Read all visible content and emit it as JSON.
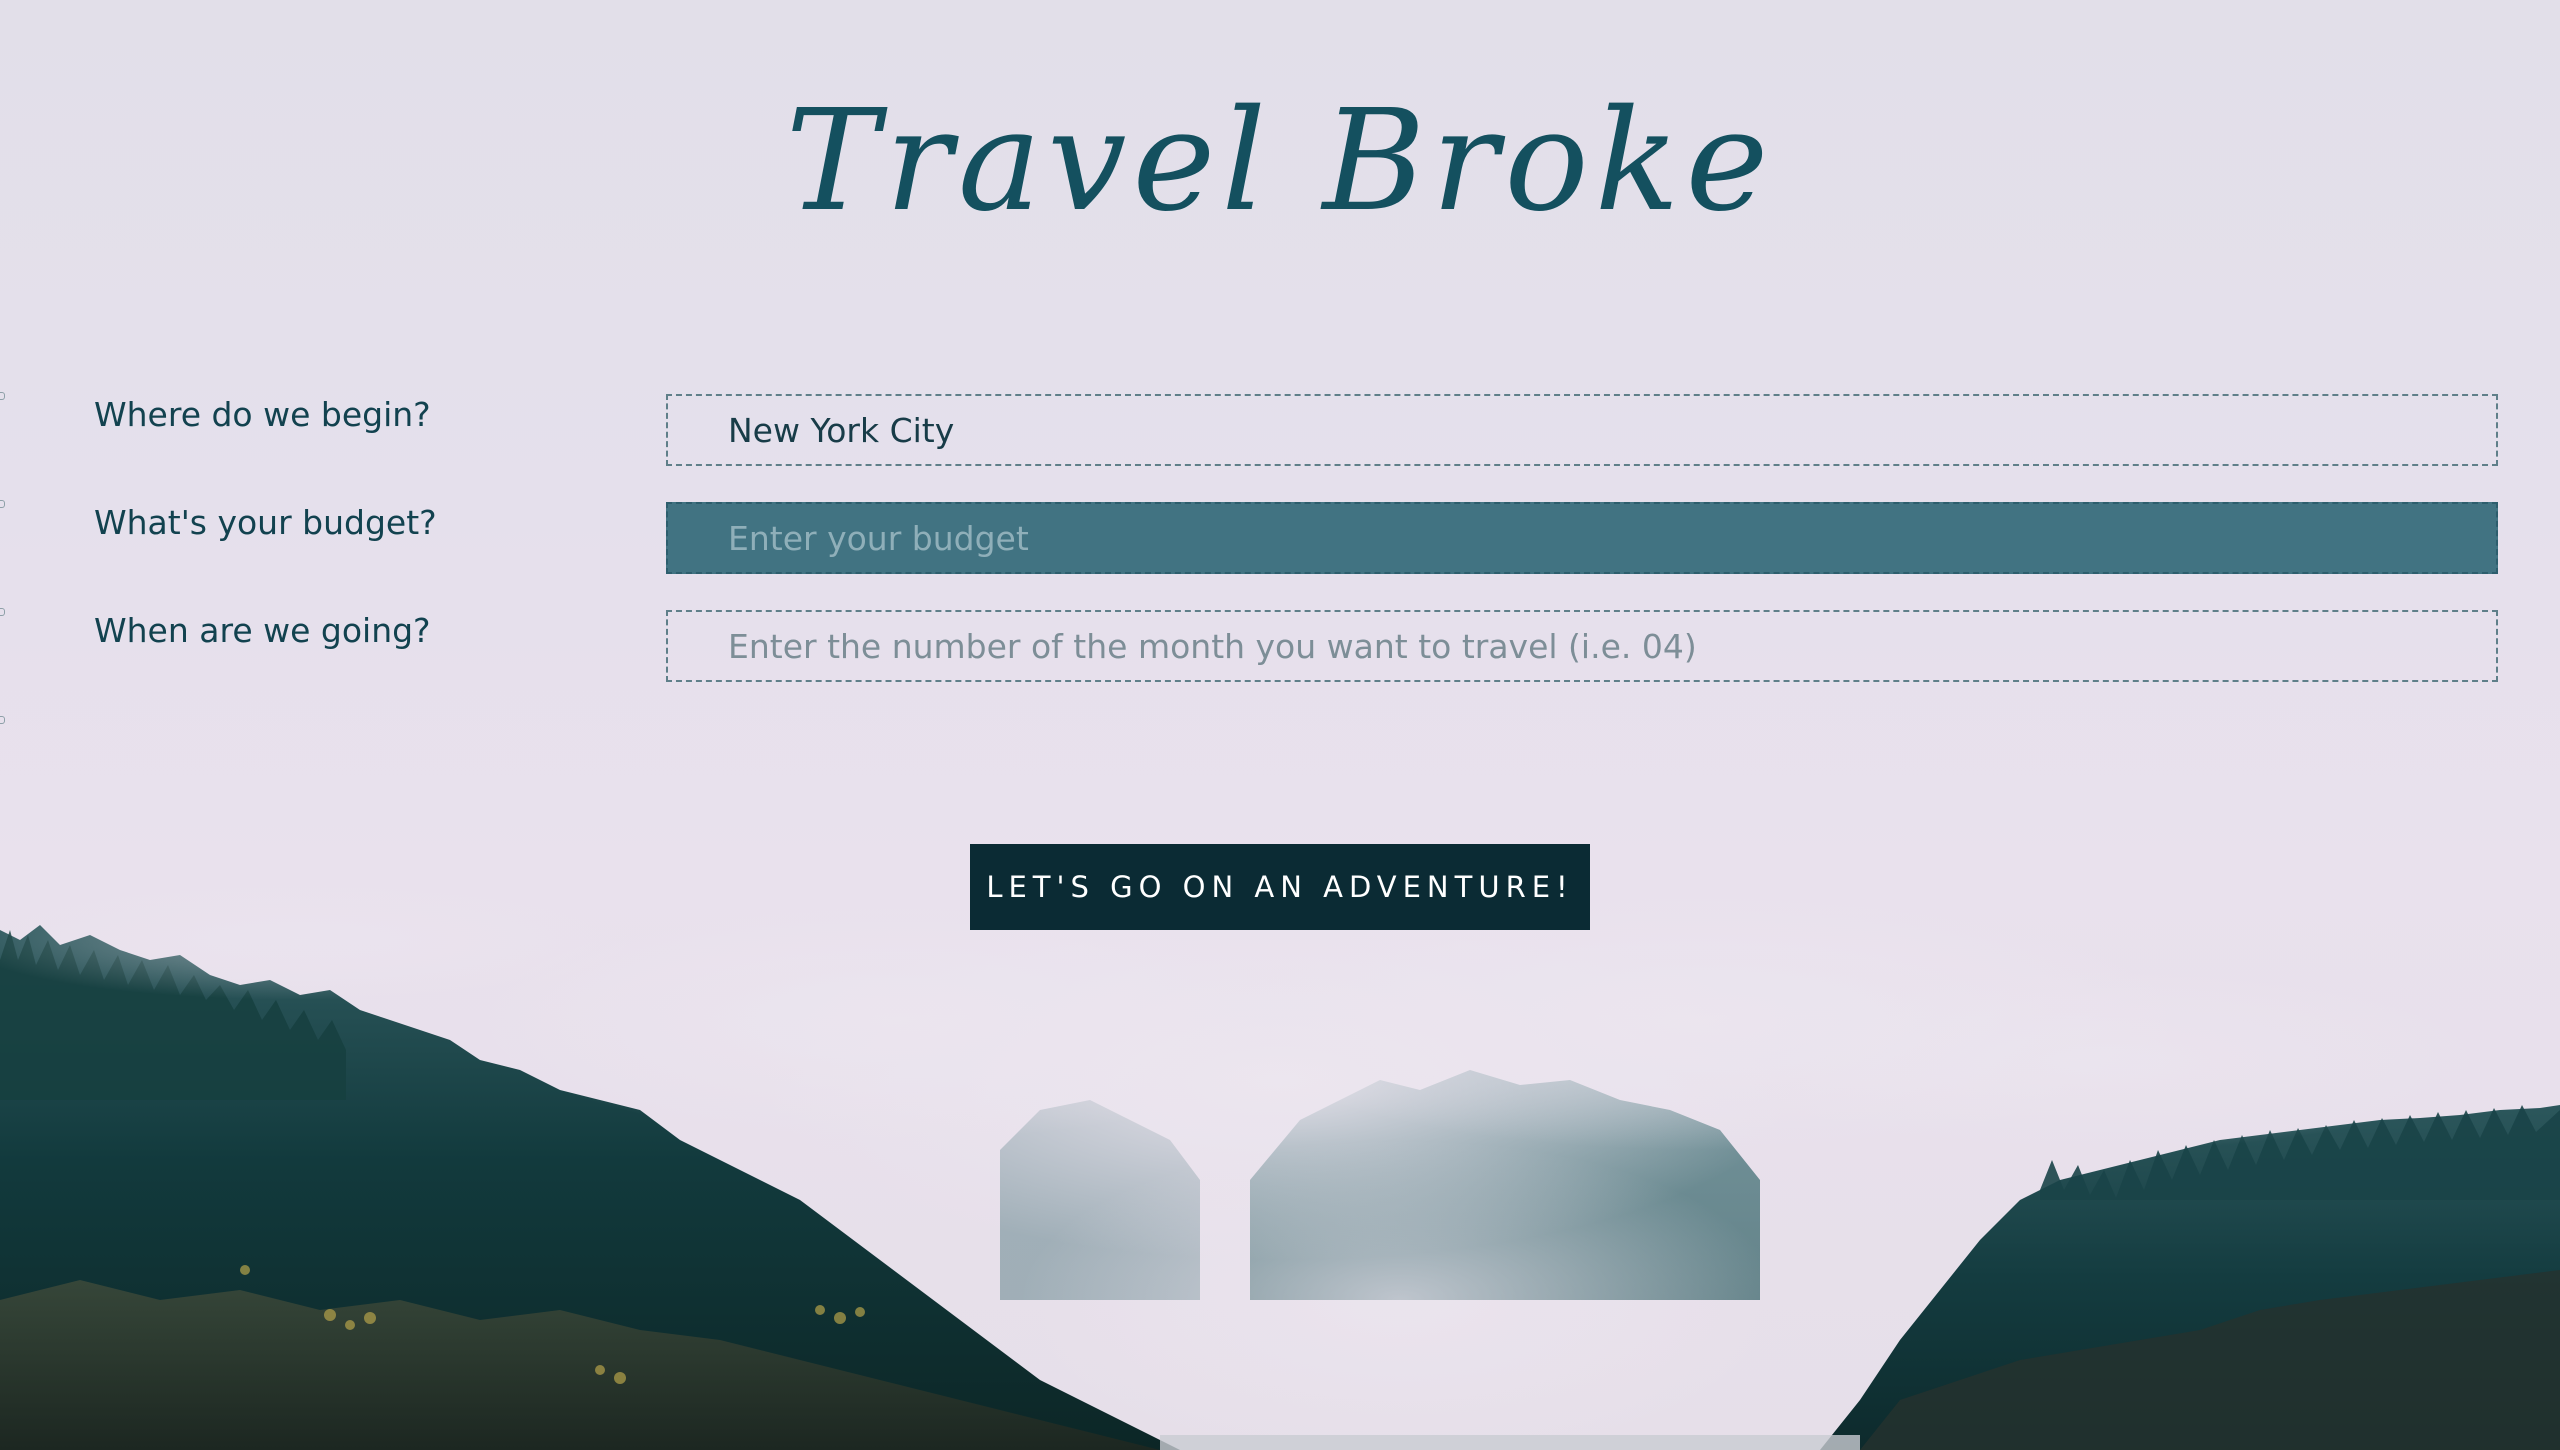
{
  "header": {
    "title": "Travel Broke"
  },
  "form": {
    "origin": {
      "label": "Where do we begin?",
      "value": "New York City",
      "placeholder": ""
    },
    "budget": {
      "label": "What's your budget?",
      "value": "",
      "placeholder": "Enter your budget"
    },
    "month": {
      "label": "When are we going?",
      "value": "",
      "placeholder": "Enter the number of the month you want to travel (i.e. 04)"
    }
  },
  "actions": {
    "submit_label": "LET'S GO ON AN ADVENTURE!"
  },
  "colors": {
    "title": "#14505f",
    "active_field": "#417382",
    "button": "#0b2b34",
    "background": "#e5e0ec"
  },
  "background_image": {
    "description_icon": "misty-forest-mountains-image"
  }
}
